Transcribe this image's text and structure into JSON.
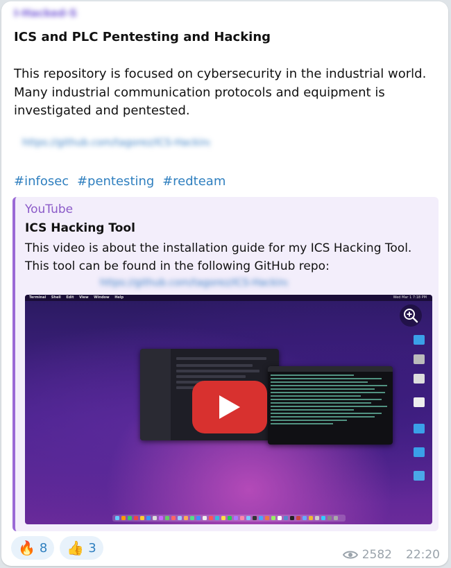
{
  "post": {
    "sender": "I-Hacked-S",
    "title": "ICS and PLC Pentesting and Hacking",
    "body_line1": "This repository is focused on cybersecurity in the industrial world.",
    "body_line2": "Many industrial communication protocols and equipment is",
    "body_line3": "investigated and pentested.",
    "blurred_link": "https://github.com/tagorez/ICS-Hacking",
    "hashtags": [
      "#infosec",
      "#pentesting",
      "#redteam"
    ]
  },
  "preview": {
    "site": "YouTube",
    "title": "ICS Hacking Tool",
    "desc_line1": "This video is about the installation guide for my ICS Hacking Tool.",
    "desc_line2": "This tool can be found in the following GitHub repo:",
    "blurred_link": "https://github.com/tagorez/ICS-Hacking-Tool",
    "video": {
      "menu_items": [
        "Terminal",
        "Shell",
        "Edit",
        "View",
        "Window",
        "Help"
      ],
      "clock": "Wed Mar 1 7:18 PM"
    }
  },
  "reactions": [
    {
      "emoji": "🔥",
      "count": "8"
    },
    {
      "emoji": "👍",
      "count": "3"
    }
  ],
  "meta": {
    "views": "2582",
    "time": "22:20"
  },
  "colors": {
    "accent": "#2f7fbf",
    "preview_bar": "#9b6ad6",
    "play_button": "#d8312f"
  }
}
